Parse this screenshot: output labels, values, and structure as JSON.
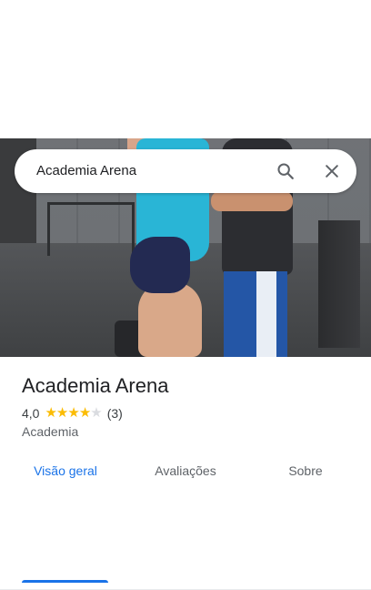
{
  "search": {
    "query": "Academia Arena",
    "search_icon": "search-icon",
    "close_icon": "close-icon"
  },
  "place": {
    "name": "Academia Arena",
    "rating": "4,0",
    "rating_value": 4.0,
    "rating_max": 5,
    "review_count": "(3)",
    "category": "Academia"
  },
  "hero_photo": {
    "description_icon": "photo"
  },
  "tabs": [
    {
      "label": "Visão geral",
      "active": true
    },
    {
      "label": "Avaliações",
      "active": false
    },
    {
      "label": "Sobre",
      "active": false
    }
  ],
  "colors": {
    "accent": "#1a73e8",
    "star": "#fbbc04",
    "star_off": "#dadce0",
    "text": "#202124",
    "secondary_text": "#5f6368"
  }
}
